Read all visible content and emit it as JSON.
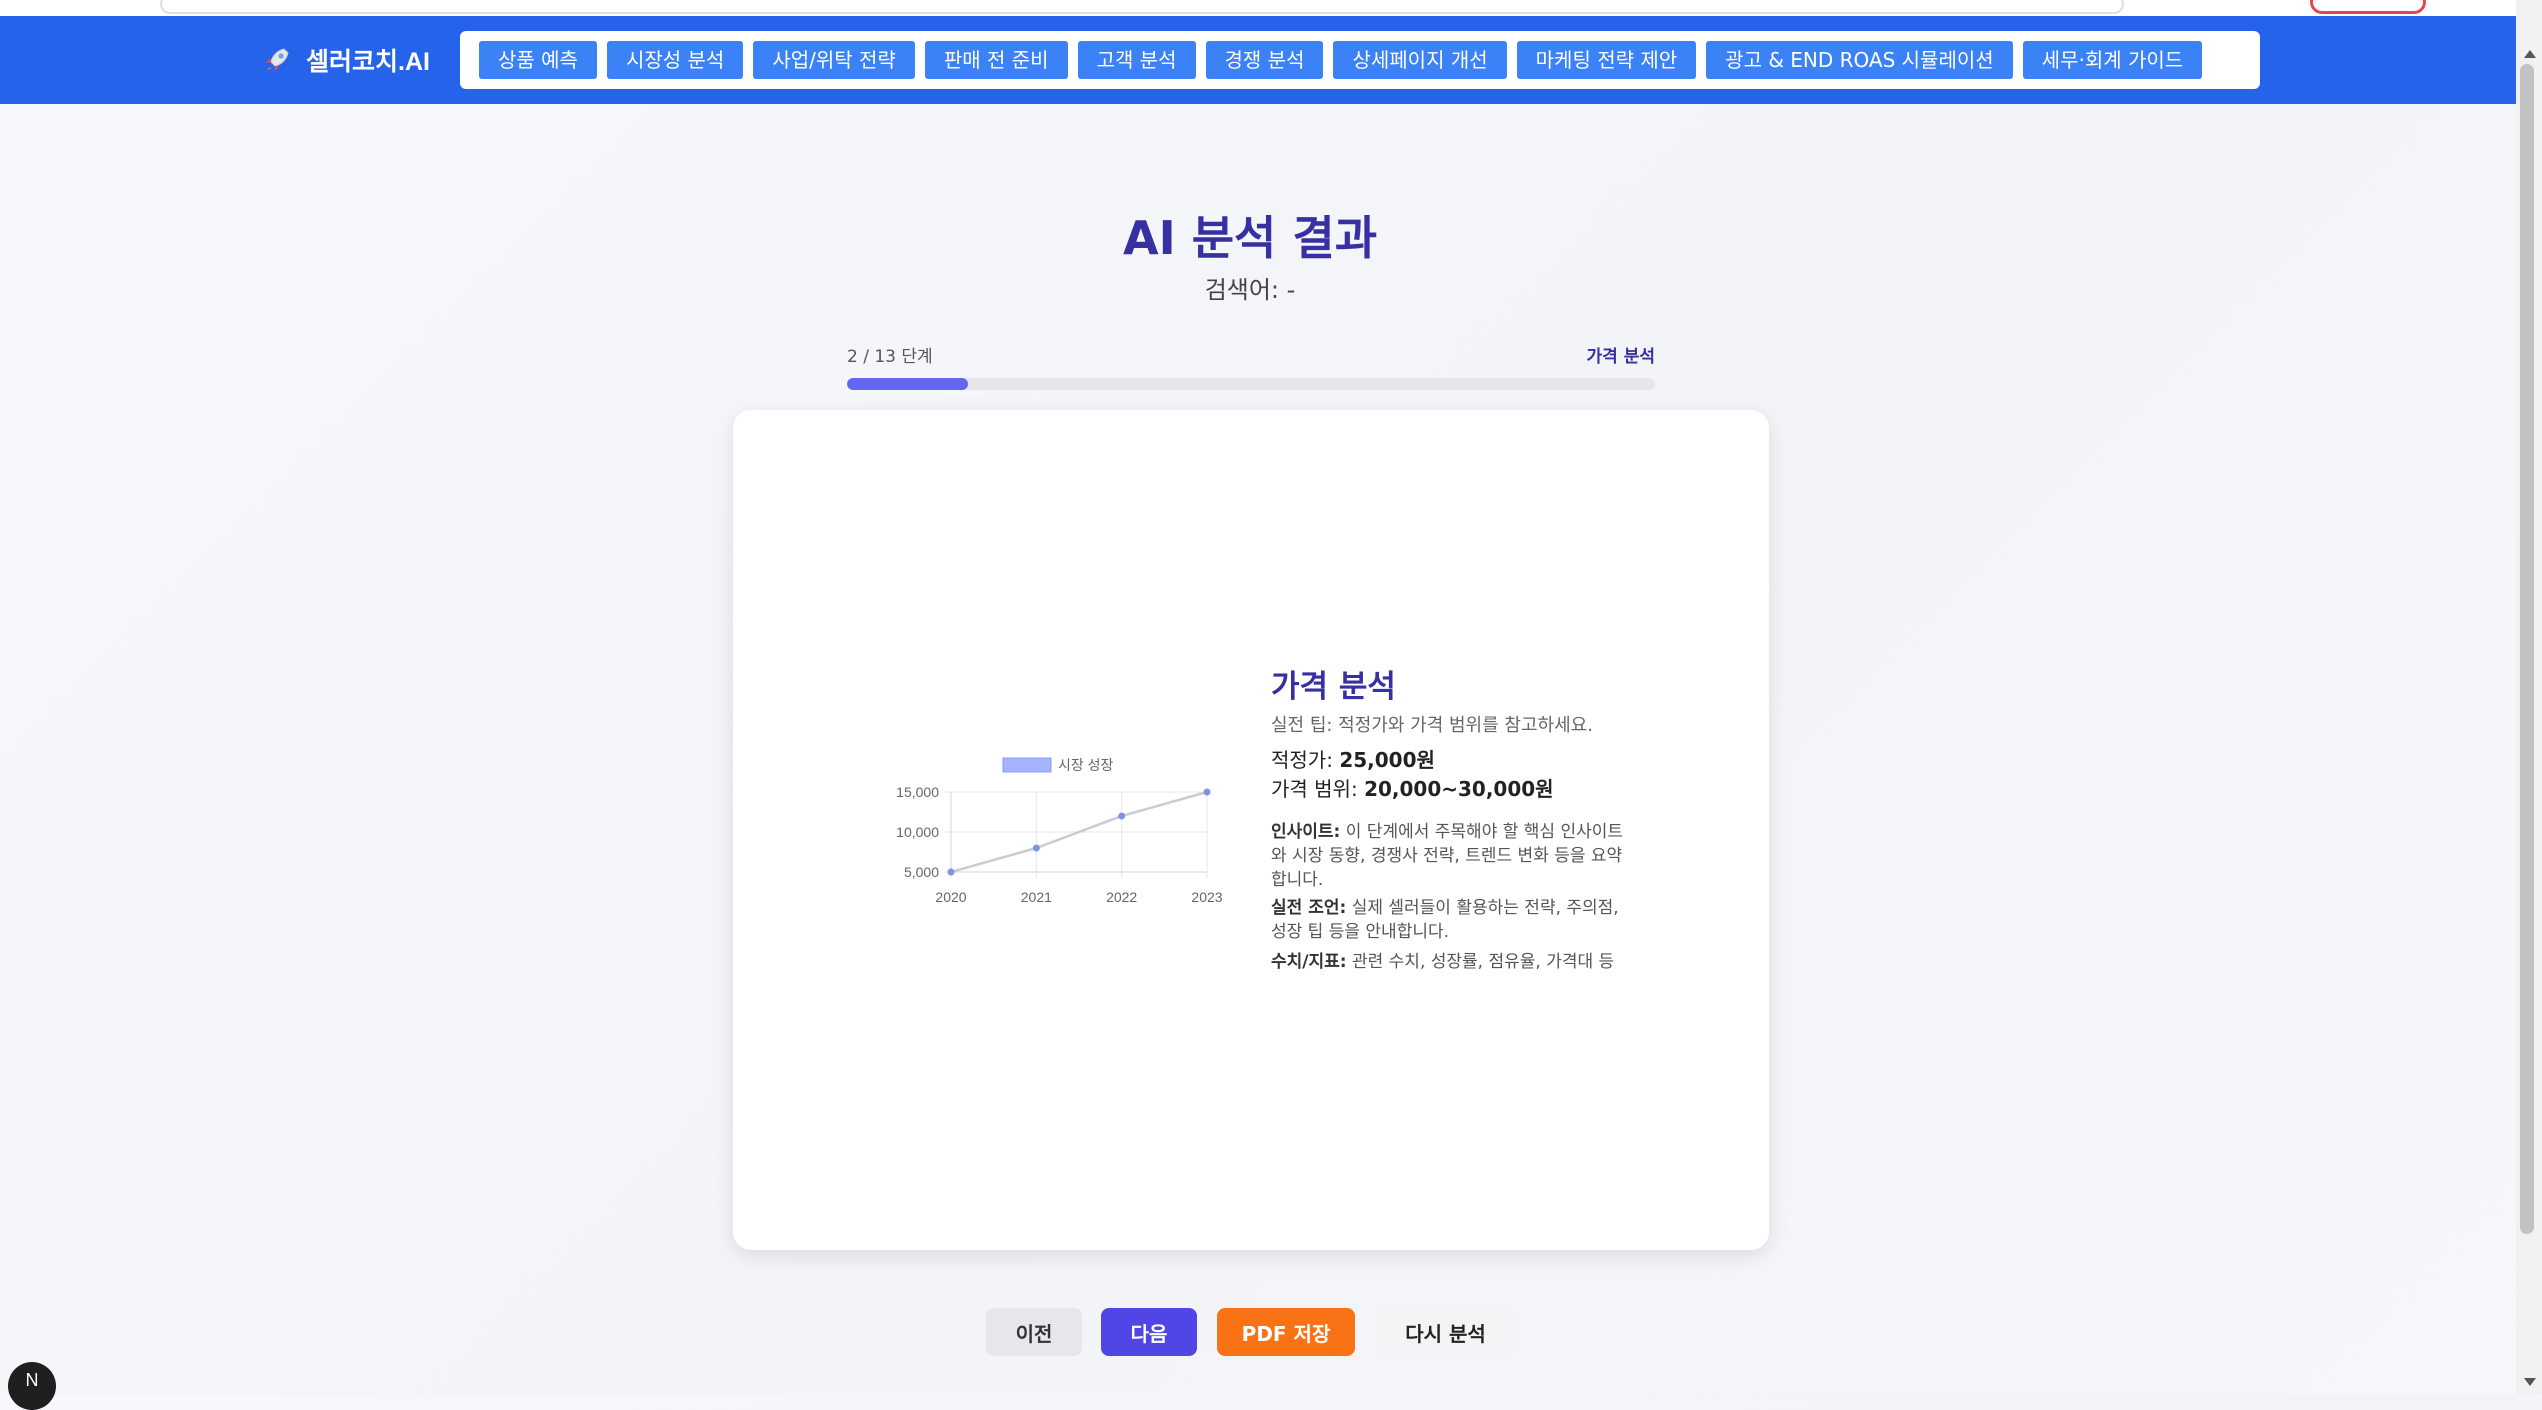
{
  "brand": {
    "name": "셀러코치.AI",
    "icon": "rocket-icon"
  },
  "nav": {
    "items": [
      {
        "label": "상품 예측"
      },
      {
        "label": "시장성 분석"
      },
      {
        "label": "사업/위탁 전략"
      },
      {
        "label": "판매 전 준비"
      },
      {
        "label": "고객 분석"
      },
      {
        "label": "경쟁 분석"
      },
      {
        "label": "상세페이지 개선"
      },
      {
        "label": "마케팅 전략 제안"
      },
      {
        "label": "광고 & END ROAS 시뮬레이션"
      },
      {
        "label": "세무·회계 가이드"
      }
    ]
  },
  "header": {
    "title": "AI 분석 결과",
    "keyword_line": "검색어: -"
  },
  "progress": {
    "step_label": "2 / 13 단계",
    "stage_name": "가격 분석",
    "current": 2,
    "total": 13,
    "fraction": 0.15
  },
  "result": {
    "title": "가격 분석",
    "tip": "실전 팁: 적정가와 가격 범위를 참고하세요.",
    "fair_price_label": "적정가:",
    "fair_price_value": "25,000원",
    "range_label": "가격 범위:",
    "range_value": "20,000~30,000원",
    "insight_label": "인사이트:",
    "insight_text": "이 단계에서 주목해야 할 핵심 인사이트와 시장 동향, 경쟁사 전략, 트렌드 변화 등을 요약합니다.",
    "advice_label": "실전 조언:",
    "advice_text": "실제 셀러들이 활용하는 전략, 주의점, 성장 팁 등을 안내합니다.",
    "metrics_label": "수치/지표:",
    "metrics_text": "관련 수치, 성장률, 점유율, 가격대 등"
  },
  "chart_data": {
    "type": "line",
    "x": [
      "2020",
      "2021",
      "2022",
      "2023"
    ],
    "series": [
      {
        "name": "시장 성장",
        "values": [
          5000,
          8000,
          12000,
          15000
        ]
      }
    ],
    "y_ticks": [
      "5,000",
      "10,000",
      "15,000"
    ],
    "ylim": [
      5000,
      15000
    ],
    "legend": "top",
    "grid": true,
    "colors": {
      "line": "#c9ccd3",
      "point": "#7e93e8",
      "legend": "#a5b4fc"
    }
  },
  "buttons": {
    "prev": "이전",
    "next": "다음",
    "pdf": "PDF 저장",
    "retry": "다시 분석"
  },
  "floating": {
    "label": "N"
  },
  "colors": {
    "nav_bg": "#2563eb",
    "nav_item": "#3b82f6",
    "accent": "#3730a3",
    "progress": "#6366f1",
    "next": "#4f46e5",
    "pdf": "#f97316"
  }
}
